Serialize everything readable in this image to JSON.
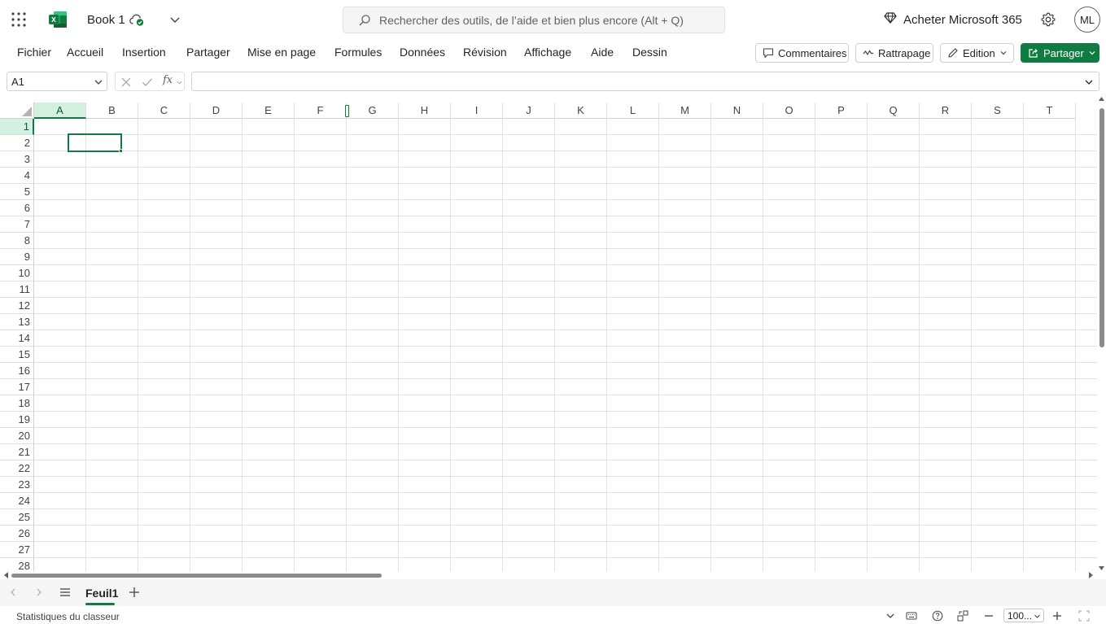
{
  "app": {
    "doc_name": "Book 1",
    "brand_color": "#107c41"
  },
  "search": {
    "placeholder": "Rechercher des outils, de l’aide et bien plus encore (Alt + Q)"
  },
  "header_right": {
    "buy_label": "Acheter Microsoft 365",
    "avatar_initials": "ML"
  },
  "menu": {
    "items": [
      "Fichier",
      "Accueil",
      "Insertion",
      "Partager",
      "Mise en page",
      "Formules",
      "Données",
      "Révision",
      "Affichage",
      "Aide",
      "Dessin"
    ],
    "comments_label": "Commentaires",
    "catchup_label": "Rattrapage",
    "edit_label": "Edition",
    "share_label": "Partager"
  },
  "formula_bar": {
    "name_box": "A1",
    "fx_label": "fx",
    "formula_value": ""
  },
  "grid": {
    "columns": [
      "A",
      "B",
      "C",
      "D",
      "E",
      "F",
      "G",
      "H",
      "I",
      "J",
      "K",
      "L",
      "M",
      "N",
      "O",
      "P",
      "Q",
      "R",
      "S",
      "T"
    ],
    "rows": [
      "1",
      "2",
      "3",
      "4",
      "5",
      "6",
      "7",
      "8",
      "9",
      "10",
      "11",
      "12",
      "13",
      "14",
      "15",
      "16",
      "17",
      "18",
      "19",
      "20",
      "21",
      "22",
      "23",
      "24",
      "25",
      "26",
      "27",
      "28"
    ],
    "selected_column": "A",
    "selected_row": "1"
  },
  "sheets": {
    "tabs": [
      "Feuil1"
    ],
    "active": "Feuil1"
  },
  "status": {
    "workbook_stats": "Statistiques du classeur",
    "zoom": "100..."
  },
  "icons": {
    "waffle": "app-launcher-icon",
    "logo": "excel-logo-icon",
    "cloud": "cloud-saved-icon",
    "search": "search-icon",
    "premium": "diamond-icon",
    "settings": "gear-icon"
  }
}
